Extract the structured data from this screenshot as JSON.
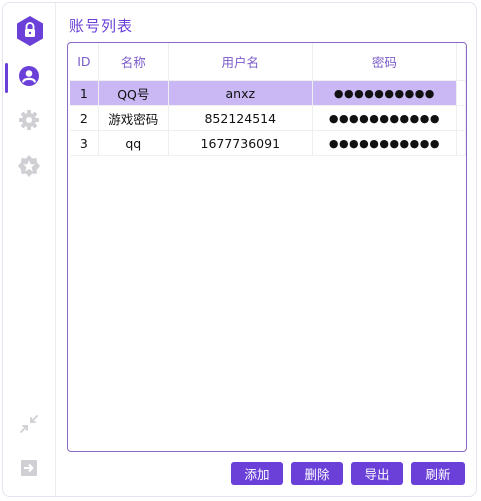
{
  "page_title": "账号列表",
  "colors": {
    "accent": "#6a40d8",
    "selected_row": "#c9b8f4",
    "icon_inactive": "#cfcfd4"
  },
  "sidebar": {
    "logo_icon": "shield-lock-icon",
    "items": [
      {
        "icon": "user-icon",
        "active": true
      },
      {
        "icon": "gear-icon",
        "active": false
      },
      {
        "icon": "star-badge-icon",
        "active": false
      }
    ],
    "bottom": [
      {
        "icon": "collapse-arrows-icon"
      },
      {
        "icon": "logout-icon"
      }
    ]
  },
  "table": {
    "columns": [
      "ID",
      "名称",
      "用户名",
      "密码"
    ],
    "rows": [
      {
        "id": "1",
        "name": "QQ号",
        "username": "anxz",
        "password": "●●●●●●●●●●"
      },
      {
        "id": "2",
        "name": "游戏密码",
        "username": "852124514",
        "password": "●●●●●●●●●●●"
      },
      {
        "id": "3",
        "name": "qq",
        "username": "1677736091",
        "password": "●●●●●●●●●●●"
      }
    ],
    "selected_row_index": 0
  },
  "buttons": {
    "add": "添加",
    "delete": "删除",
    "export": "导出",
    "refresh": "刷新"
  }
}
